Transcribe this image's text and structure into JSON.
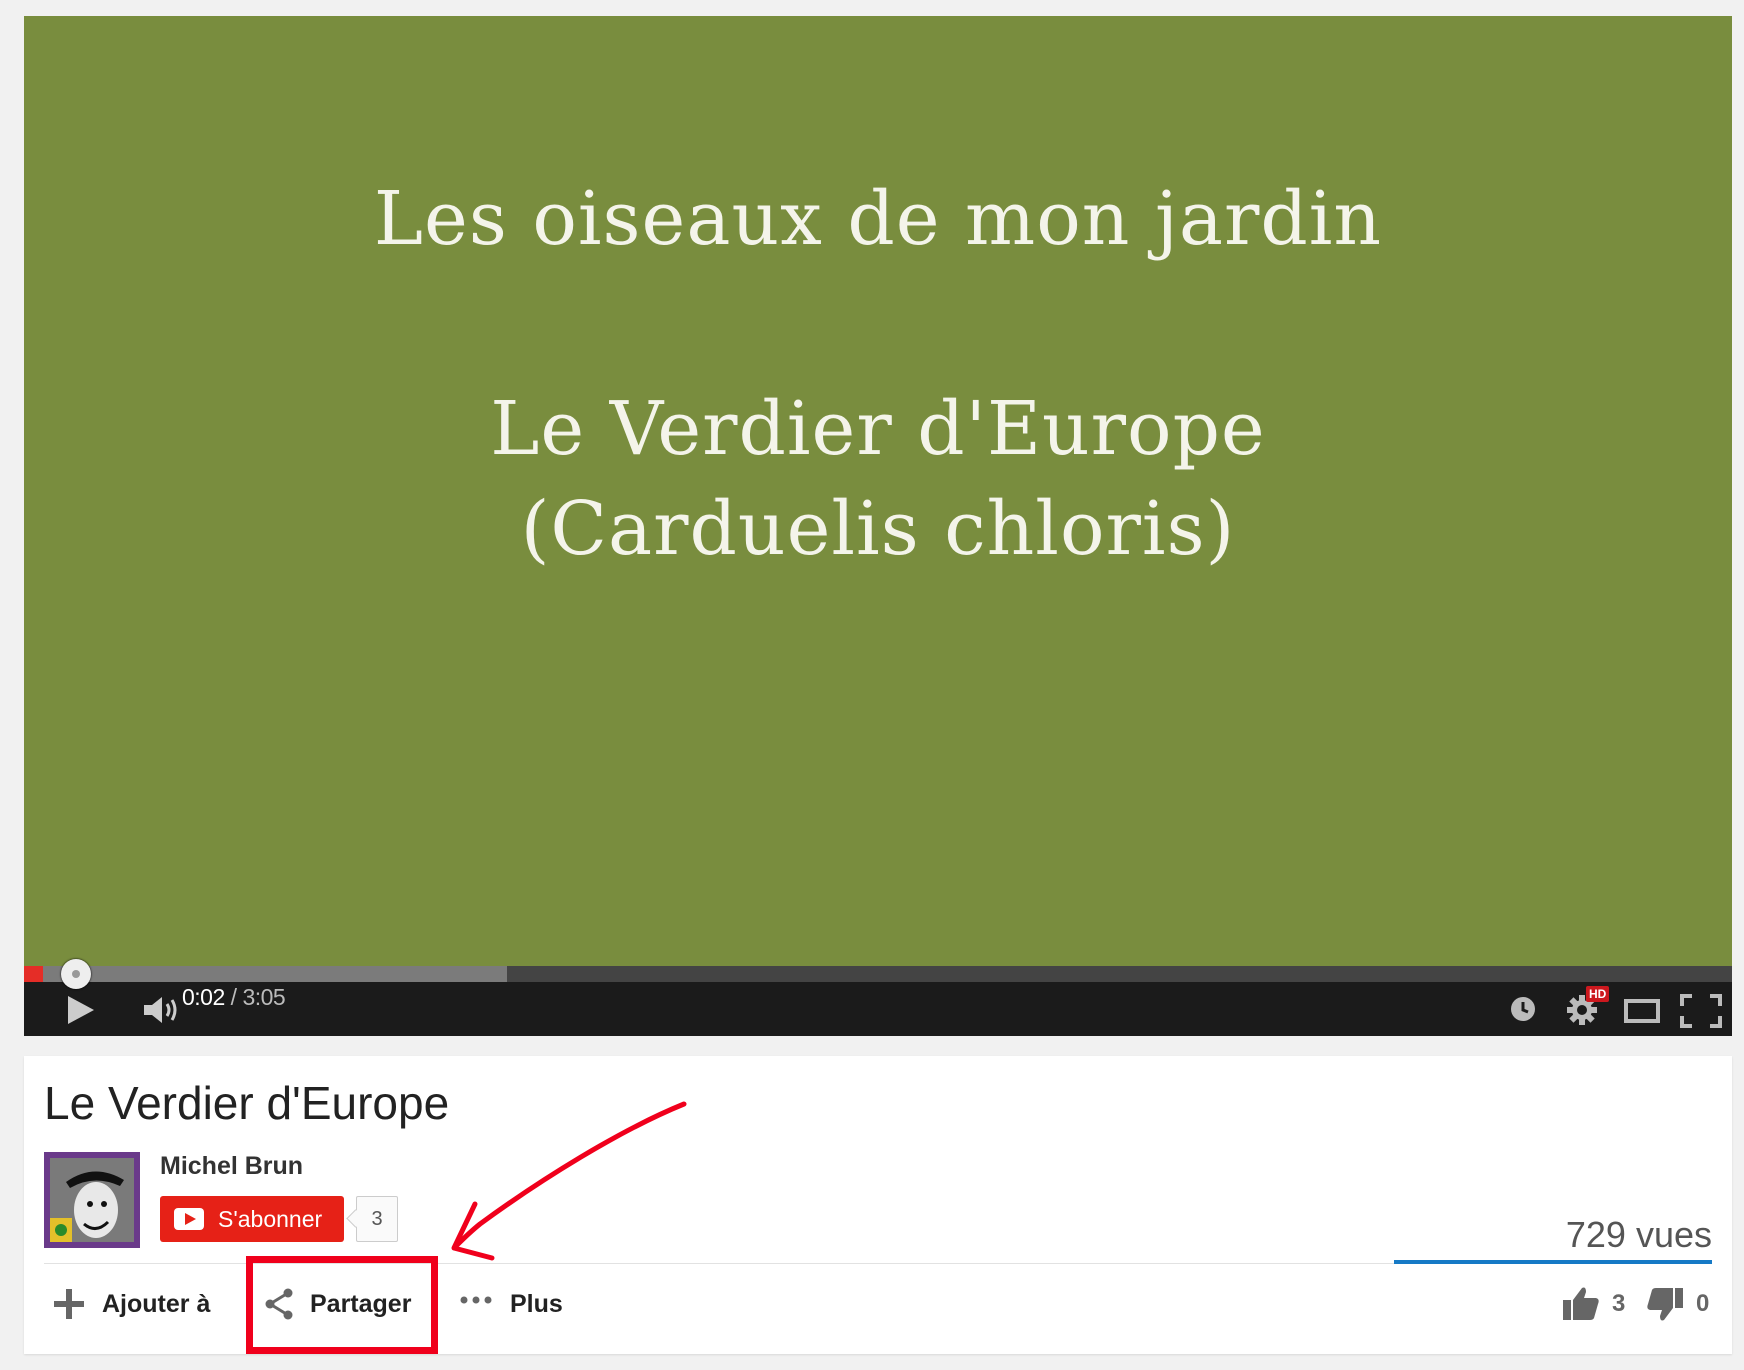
{
  "video": {
    "slide_line1": "Les oiseaux de mon jardin",
    "slide_line2": "Le Verdier d'Europe",
    "slide_line3": "(Carduelis chloris)",
    "progress_played_fraction": 0.011,
    "progress_buffered_fraction": 0.283
  },
  "controls": {
    "current_time": "0:02",
    "separator": " / ",
    "duration": "3:05",
    "hd_badge": "HD",
    "icons": [
      "play-icon",
      "volume-icon",
      "watch-later-icon",
      "settings-icon",
      "theater-mode-icon",
      "fullscreen-icon"
    ]
  },
  "info": {
    "title": "Le Verdier d'Europe",
    "channel_name": "Michel Brun",
    "subscribe_label": "S'abonner",
    "subscriber_count": "3",
    "views": "729 vues",
    "actions": {
      "add_label": "Ajouter à",
      "share_label": "Partager",
      "more_label": "Plus"
    },
    "likes": "3",
    "dislikes": "0"
  },
  "colors": {
    "video_bg": "#798d3e",
    "accent_red": "#e62117",
    "like_bar": "#167ac6",
    "annotation": "#f0001c"
  }
}
